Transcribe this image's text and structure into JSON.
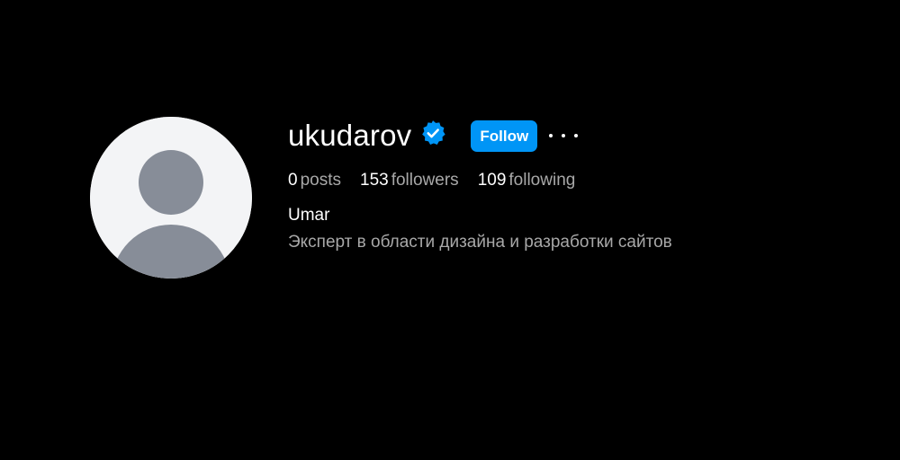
{
  "profile": {
    "username": "ukudarov",
    "verified": true,
    "follow_label": "Follow",
    "more_icon": "more-horizontal-icon",
    "stats": {
      "posts": {
        "value": "0",
        "label": "posts"
      },
      "followers": {
        "value": "153",
        "label": "followers"
      },
      "following": {
        "value": "109",
        "label": "following"
      }
    },
    "full_name": "Umar",
    "bio": "Эксперт в области дизайна и разработки сайтов"
  },
  "colors": {
    "background": "#000000",
    "accent": "#0095f6",
    "secondary_text": "#a8a8a8",
    "avatar_bg": "#f3f4f6",
    "avatar_fg": "#878d98"
  }
}
